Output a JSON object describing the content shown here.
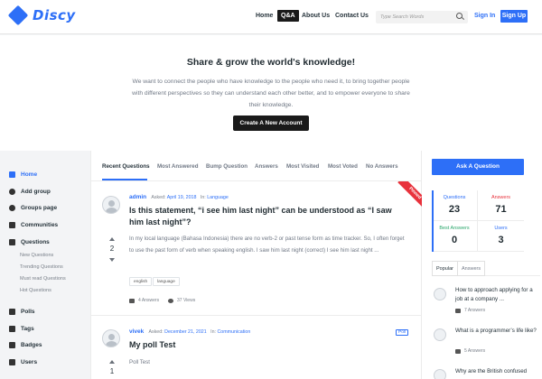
{
  "header": {
    "logo_text": "Discy",
    "nav": [
      "Home",
      "Q&A",
      "About Us",
      "Contact Us"
    ],
    "active_nav": "Q&A",
    "search_placeholder": "Type Search Words",
    "sign_in": "Sign In",
    "sign_up": "Sign Up",
    "accent_color": "#2d6ff7"
  },
  "hero": {
    "title": "Share & grow the world's knowledge!",
    "text": "We want to connect the people who have knowledge to the people who need it, to bring together people with different perspectives so they can understand each other better, and to empower everyone to share their knowledge.",
    "button": "Create A New Account"
  },
  "sidebar": {
    "items": [
      {
        "label": "Home",
        "icon": "home-icon",
        "active": true
      },
      {
        "label": "Add group",
        "icon": "globe-icon"
      },
      {
        "label": "Groups page",
        "icon": "globe-icon"
      },
      {
        "label": "Communities",
        "icon": "folder-icon"
      },
      {
        "label": "Questions",
        "icon": "book-icon"
      }
    ],
    "sub_items": [
      "New Questions",
      "Trending Questions",
      "Must read Questions",
      "Hot Questions"
    ],
    "more_items": [
      {
        "label": "Polls",
        "icon": "poll-icon"
      },
      {
        "label": "Tags",
        "icon": "tag-icon"
      },
      {
        "label": "Badges",
        "icon": "trophy-icon"
      },
      {
        "label": "Users",
        "icon": "users-icon"
      }
    ]
  },
  "tabs": [
    "Recent Questions",
    "Most Answered",
    "Bump Question",
    "Answers",
    "Most Visited",
    "Most Voted",
    "No Answers"
  ],
  "questions": [
    {
      "author": "admin",
      "asked_label": "Asked:",
      "date": "April 19, 2018",
      "in_label": "In:",
      "category": "Language",
      "title": "Is this statement, “i see him last night” can be understood as “I saw him last night”?",
      "votes": "2",
      "body": "In my local language (Bahasa Indonesia) there are no verb-2 or past tense form as time tracker. So, I often forget to use the past form of verb when speaking english. I saw him last night (correct) I see him last night ...",
      "tags": [
        "english",
        "language"
      ],
      "answers": "4 Answers",
      "views": "37 Views",
      "badge": "Pinned"
    },
    {
      "author": "vivek",
      "asked_label": "Asked:",
      "date": "December 21, 2021",
      "in_label": "In:",
      "category": "Communication",
      "title": "My poll Test",
      "votes": "1",
      "body": "Poll Test",
      "badge": "Poll"
    }
  ],
  "right": {
    "ask_button": "Ask A Question",
    "stats": [
      {
        "label": "Questions",
        "value": "23",
        "color": "#2d6ff7"
      },
      {
        "label": "Answers",
        "value": "71",
        "color": "#e8323c"
      },
      {
        "label": "Best Answers",
        "value": "0",
        "color": "#2aa66b"
      },
      {
        "label": "Users",
        "value": "3",
        "color": "#2d6ff7"
      }
    ],
    "pop_tabs": [
      "Popular",
      "Answers"
    ],
    "popular": [
      {
        "title": "How to approach applying for a job at a company ...",
        "answers": "7 Answers"
      },
      {
        "title": "What is a programmer’s life like?",
        "answers": "5 Answers"
      },
      {
        "title": "Why are the British confused"
      }
    ]
  }
}
